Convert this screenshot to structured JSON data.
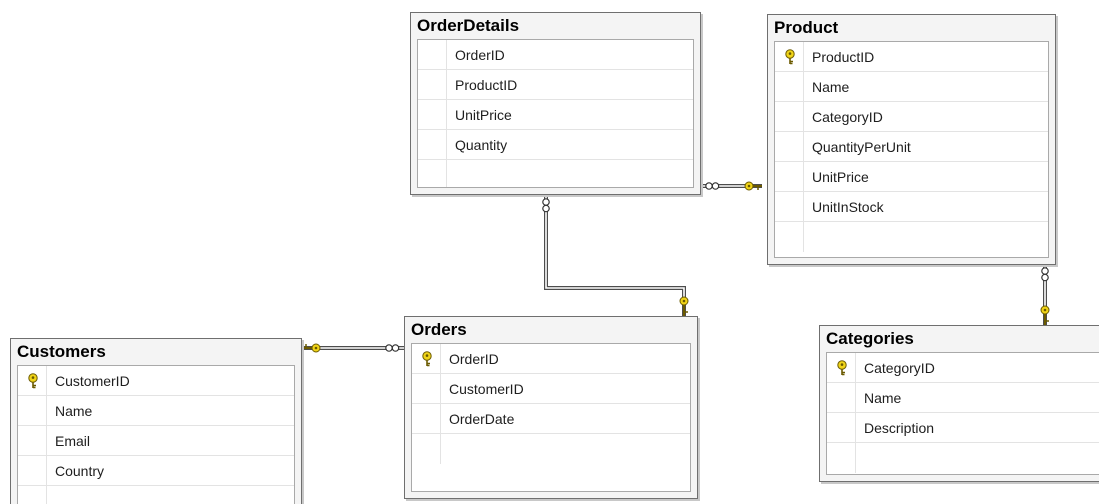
{
  "diagram": {
    "tables": {
      "orderdetails": {
        "title": "OrderDetails",
        "columns": [
          "OrderID",
          "ProductID",
          "UnitPrice",
          "Quantity"
        ],
        "primary_keys": []
      },
      "product": {
        "title": "Product",
        "columns": [
          "ProductID",
          "Name",
          "CategoryID",
          "QuantityPerUnit",
          "UnitPrice",
          "UnitInStock"
        ],
        "primary_keys": [
          "ProductID"
        ]
      },
      "orders": {
        "title": "Orders",
        "columns": [
          "OrderID",
          "CustomerID",
          "OrderDate"
        ],
        "primary_keys": [
          "OrderID"
        ]
      },
      "customers": {
        "title": "Customers",
        "columns": [
          "CustomerID",
          "Name",
          "Email",
          "Country"
        ],
        "primary_keys": [
          "CustomerID"
        ]
      },
      "categories": {
        "title": "Categories",
        "columns": [
          "CategoryID",
          "Name",
          "Description"
        ],
        "primary_keys": [
          "CategoryID"
        ]
      }
    },
    "relationships": [
      {
        "from": "OrderDetails",
        "to": "Product",
        "many_end": "OrderDetails",
        "one_end": "Product"
      },
      {
        "from": "OrderDetails",
        "to": "Orders",
        "many_end": "OrderDetails",
        "one_end": "Orders"
      },
      {
        "from": "Orders",
        "to": "Customers",
        "many_end": "Orders",
        "one_end": "Customers"
      },
      {
        "from": "Product",
        "to": "Categories",
        "many_end": "Product",
        "one_end": "Categories"
      }
    ],
    "colors": {
      "key": "#f0d418",
      "key_outline": "#6b5a00",
      "connector": "#4d4d4d",
      "table_border": "#6f6f6f"
    }
  }
}
